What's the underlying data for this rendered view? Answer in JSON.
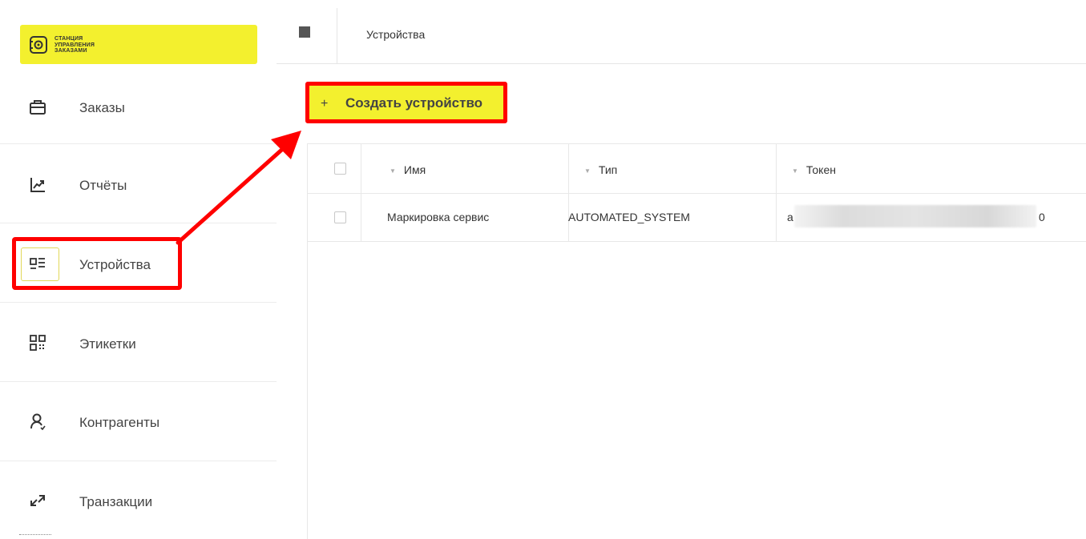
{
  "logo": {
    "line1": "СТАНЦИЯ",
    "line2": "УПРАВЛЕНИЯ",
    "line3": "ЗАКАЗАМИ"
  },
  "sidebar": {
    "items": [
      {
        "label": "Заказы",
        "icon": "briefcase-icon"
      },
      {
        "label": "Отчёты",
        "icon": "chart-icon"
      },
      {
        "label": "Устройства",
        "icon": "devices-icon"
      },
      {
        "label": "Этикетки",
        "icon": "qr-code-icon"
      },
      {
        "label": "Контрагенты",
        "icon": "user-icon"
      },
      {
        "label": "Транзакции",
        "icon": "transfer-icon"
      }
    ]
  },
  "topbar": {
    "title": "Устройства"
  },
  "actions": {
    "create_plus": "+",
    "create_label": "Создать устройство"
  },
  "table": {
    "headers": [
      "Имя",
      "Тип",
      "Токен"
    ],
    "rows": [
      {
        "name": "Маркировка сервис",
        "type": "AUTOMATED_SYSTEM",
        "token_start": "a",
        "token_end": "0"
      }
    ]
  },
  "colors": {
    "accent": "#f3f02e",
    "highlight": "#ff0000"
  }
}
